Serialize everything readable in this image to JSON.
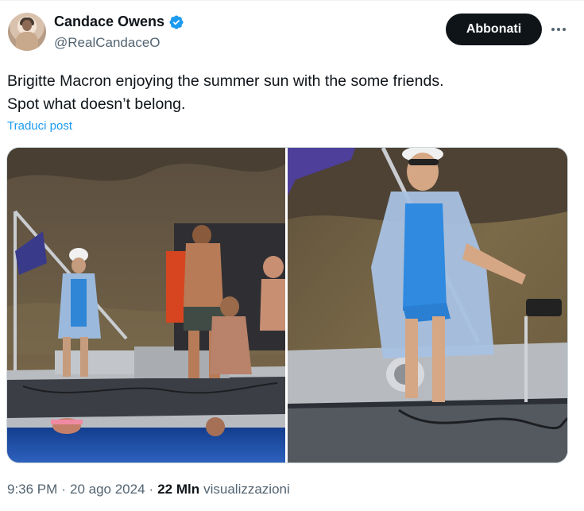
{
  "author": {
    "name": "Candace Owens",
    "handle": "@RealCandaceO",
    "verified": true
  },
  "follow_button": {
    "label": "Abbonati"
  },
  "more_icon": "more-horizontal-icon",
  "tweet": {
    "line1": "Brigitte Macron enjoying the summer sun with the some friends.",
    "line2": "Spot what doesn’t belong.",
    "translate_label": "Traduci post"
  },
  "media": {
    "count": 2,
    "photos": [
      "photo-boat-group",
      "photo-woman-standing-on-boat"
    ]
  },
  "meta": {
    "time": "9:36 PM",
    "date": "20 ago 2024",
    "views_count": "22 Mln",
    "views_label": "visualizzazioni"
  },
  "colors": {
    "accent": "#1d9bf0",
    "text": "#0f1419",
    "secondary": "#536471",
    "button_bg": "#0f1419"
  }
}
